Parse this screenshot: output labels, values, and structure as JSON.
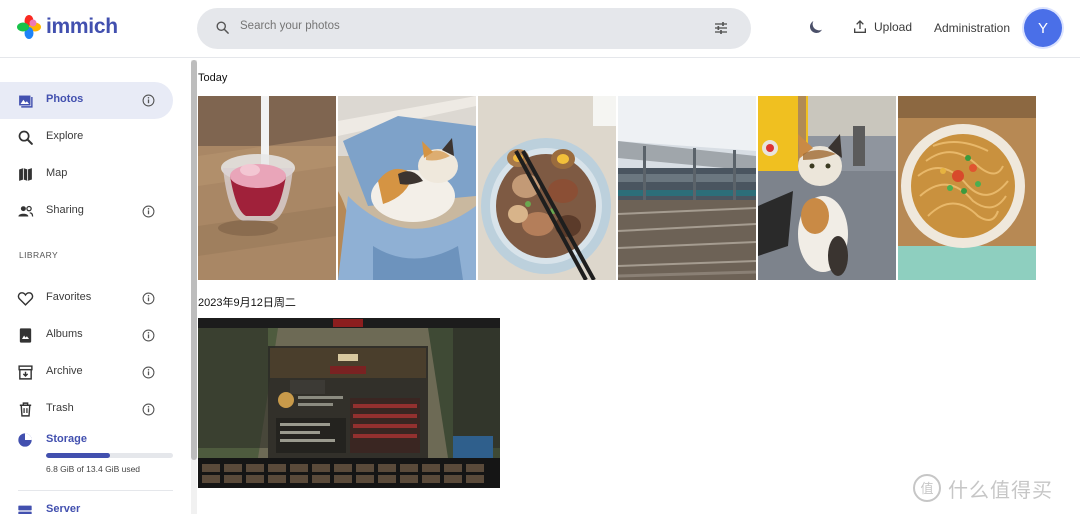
{
  "app": {
    "name": "immich"
  },
  "search": {
    "placeholder": "Search your photos"
  },
  "header": {
    "upload_label": "Upload",
    "admin_label": "Administration",
    "avatar_initial": "Y"
  },
  "sidebar": {
    "items": [
      {
        "label": "Photos",
        "icon": "photos-icon",
        "active": true
      },
      {
        "label": "Explore",
        "icon": "explore-icon"
      },
      {
        "label": "Map",
        "icon": "map-icon"
      },
      {
        "label": "Sharing",
        "icon": "sharing-icon"
      }
    ],
    "library_heading": "LIBRARY",
    "library_items": [
      {
        "label": "Favorites",
        "icon": "heart-icon"
      },
      {
        "label": "Albums",
        "icon": "albums-icon"
      },
      {
        "label": "Archive",
        "icon": "archive-icon"
      },
      {
        "label": "Trash",
        "icon": "trash-icon"
      }
    ],
    "storage": {
      "label": "Storage",
      "usage_text": "6.8 GiB of 13.4 GiB used",
      "used_fraction": 0.507
    },
    "server": {
      "label": "Server"
    }
  },
  "timeline": {
    "groups": [
      {
        "title": "Today",
        "photos": [
          "photo-dessert",
          "photo-cat-chair",
          "photo-food-bowl",
          "photo-train-station",
          "photo-cat-floor",
          "photo-noodles"
        ]
      },
      {
        "title": "2023年9月12日周二",
        "photos": [
          "photo-game-screenshot"
        ]
      }
    ]
  },
  "watermark": {
    "text": "什么值得买"
  },
  "colors": {
    "accent": "#4250af",
    "active_bg": "#e8ebf6",
    "search_bg": "#e5e7eb",
    "avatar": "#4a6fe8"
  }
}
